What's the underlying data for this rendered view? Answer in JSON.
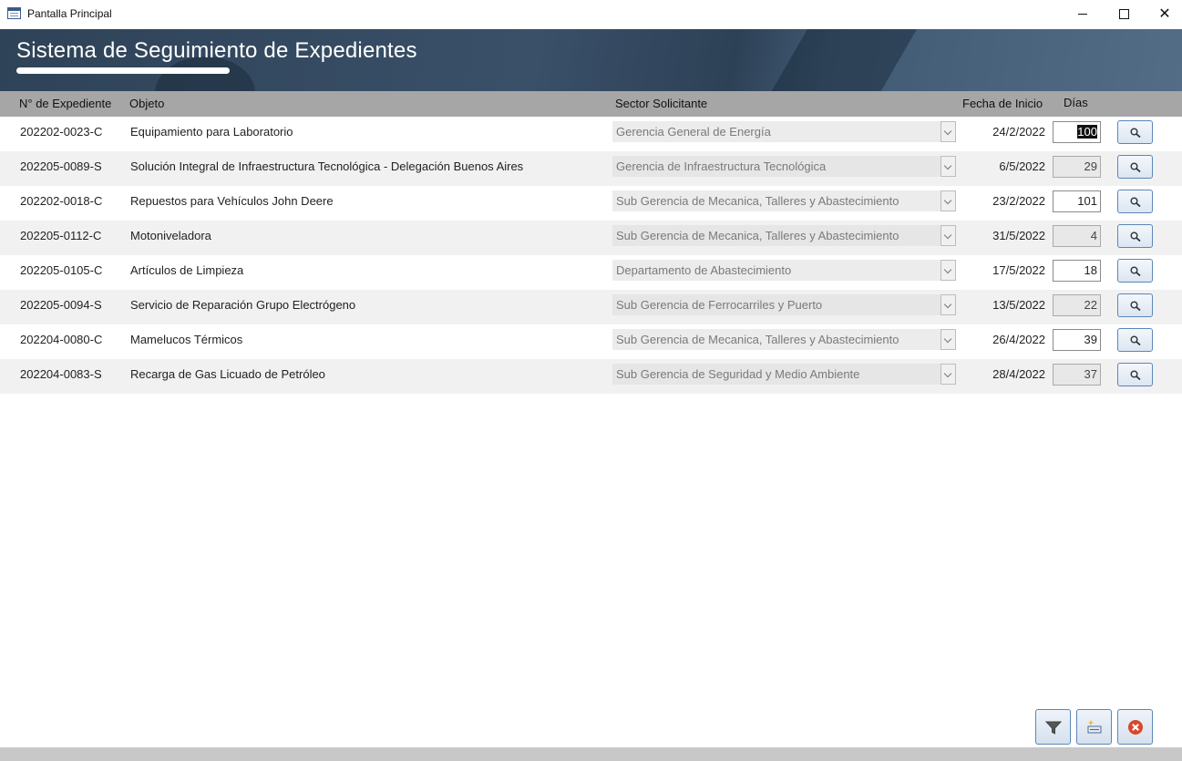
{
  "window": {
    "title": "Pantalla Principal",
    "icon": "form-icon",
    "controls": [
      "minimize-icon",
      "maximize-icon",
      "close-icon"
    ],
    "close_glyph": "✕"
  },
  "header": {
    "title": "Sistema de Seguimiento de Expedientes"
  },
  "columns": {
    "expediente": "N° de Expediente",
    "objeto": "Objeto",
    "sector": "Sector Solicitante",
    "fecha": "Fecha de Inicio",
    "dias": "Días"
  },
  "rows": [
    {
      "expediente": "202202-0023-C",
      "objeto": "Equipamiento para Laboratorio",
      "sector": "Gerencia General de Energía",
      "fecha": "24/2/2022",
      "dias": "100"
    },
    {
      "expediente": "202205-0089-S",
      "objeto": "Solución Integral de Infraestructura Tecnológica - Delegación Buenos Aires",
      "sector": "Gerencia de Infraestructura Tecnológica",
      "fecha": "6/5/2022",
      "dias": "29"
    },
    {
      "expediente": "202202-0018-C",
      "objeto": "Repuestos para Vehículos John Deere",
      "sector": "Sub Gerencia de Mecanica, Talleres y Abastecimiento",
      "fecha": "23/2/2022",
      "dias": "101"
    },
    {
      "expediente": "202205-0112-C",
      "objeto": "Motoniveladora",
      "sector": "Sub Gerencia de Mecanica, Talleres y Abastecimiento",
      "fecha": "31/5/2022",
      "dias": "4"
    },
    {
      "expediente": "202205-0105-C",
      "objeto": "Artículos de Limpieza",
      "sector": "Departamento de Abastecimiento",
      "fecha": "17/5/2022",
      "dias": "18"
    },
    {
      "expediente": "202205-0094-S",
      "objeto": "Servicio de Reparación Grupo Electrógeno",
      "sector": "Sub Gerencia de Ferrocarriles y Puerto",
      "fecha": "13/5/2022",
      "dias": "22"
    },
    {
      "expediente": "202204-0080-C",
      "objeto": "Mamelucos Térmicos",
      "sector": "Sub Gerencia de Mecanica, Talleres y Abastecimiento",
      "fecha": "26/4/2022",
      "dias": "39"
    },
    {
      "expediente": "202204-0083-S",
      "objeto": "Recarga de Gas Licuado de Petróleo",
      "sector": "Sub Gerencia de Seguridad y Medio Ambiente",
      "fecha": "28/4/2022",
      "dias": "37"
    }
  ],
  "row_actions": {
    "detail_icon": "search-icon"
  },
  "bottom_buttons": [
    {
      "name": "filter-button",
      "icon": "filter-icon"
    },
    {
      "name": "new-record-button",
      "icon": "new-record-icon"
    },
    {
      "name": "close-form-button",
      "icon": "close-circle-icon",
      "color": "#d9472b"
    }
  ],
  "colors": {
    "header_bg": "#3a5069",
    "column_header_bg": "#a6a6a6",
    "alt_row_bg": "#f1f1f1",
    "button_border": "#5b86b8"
  }
}
